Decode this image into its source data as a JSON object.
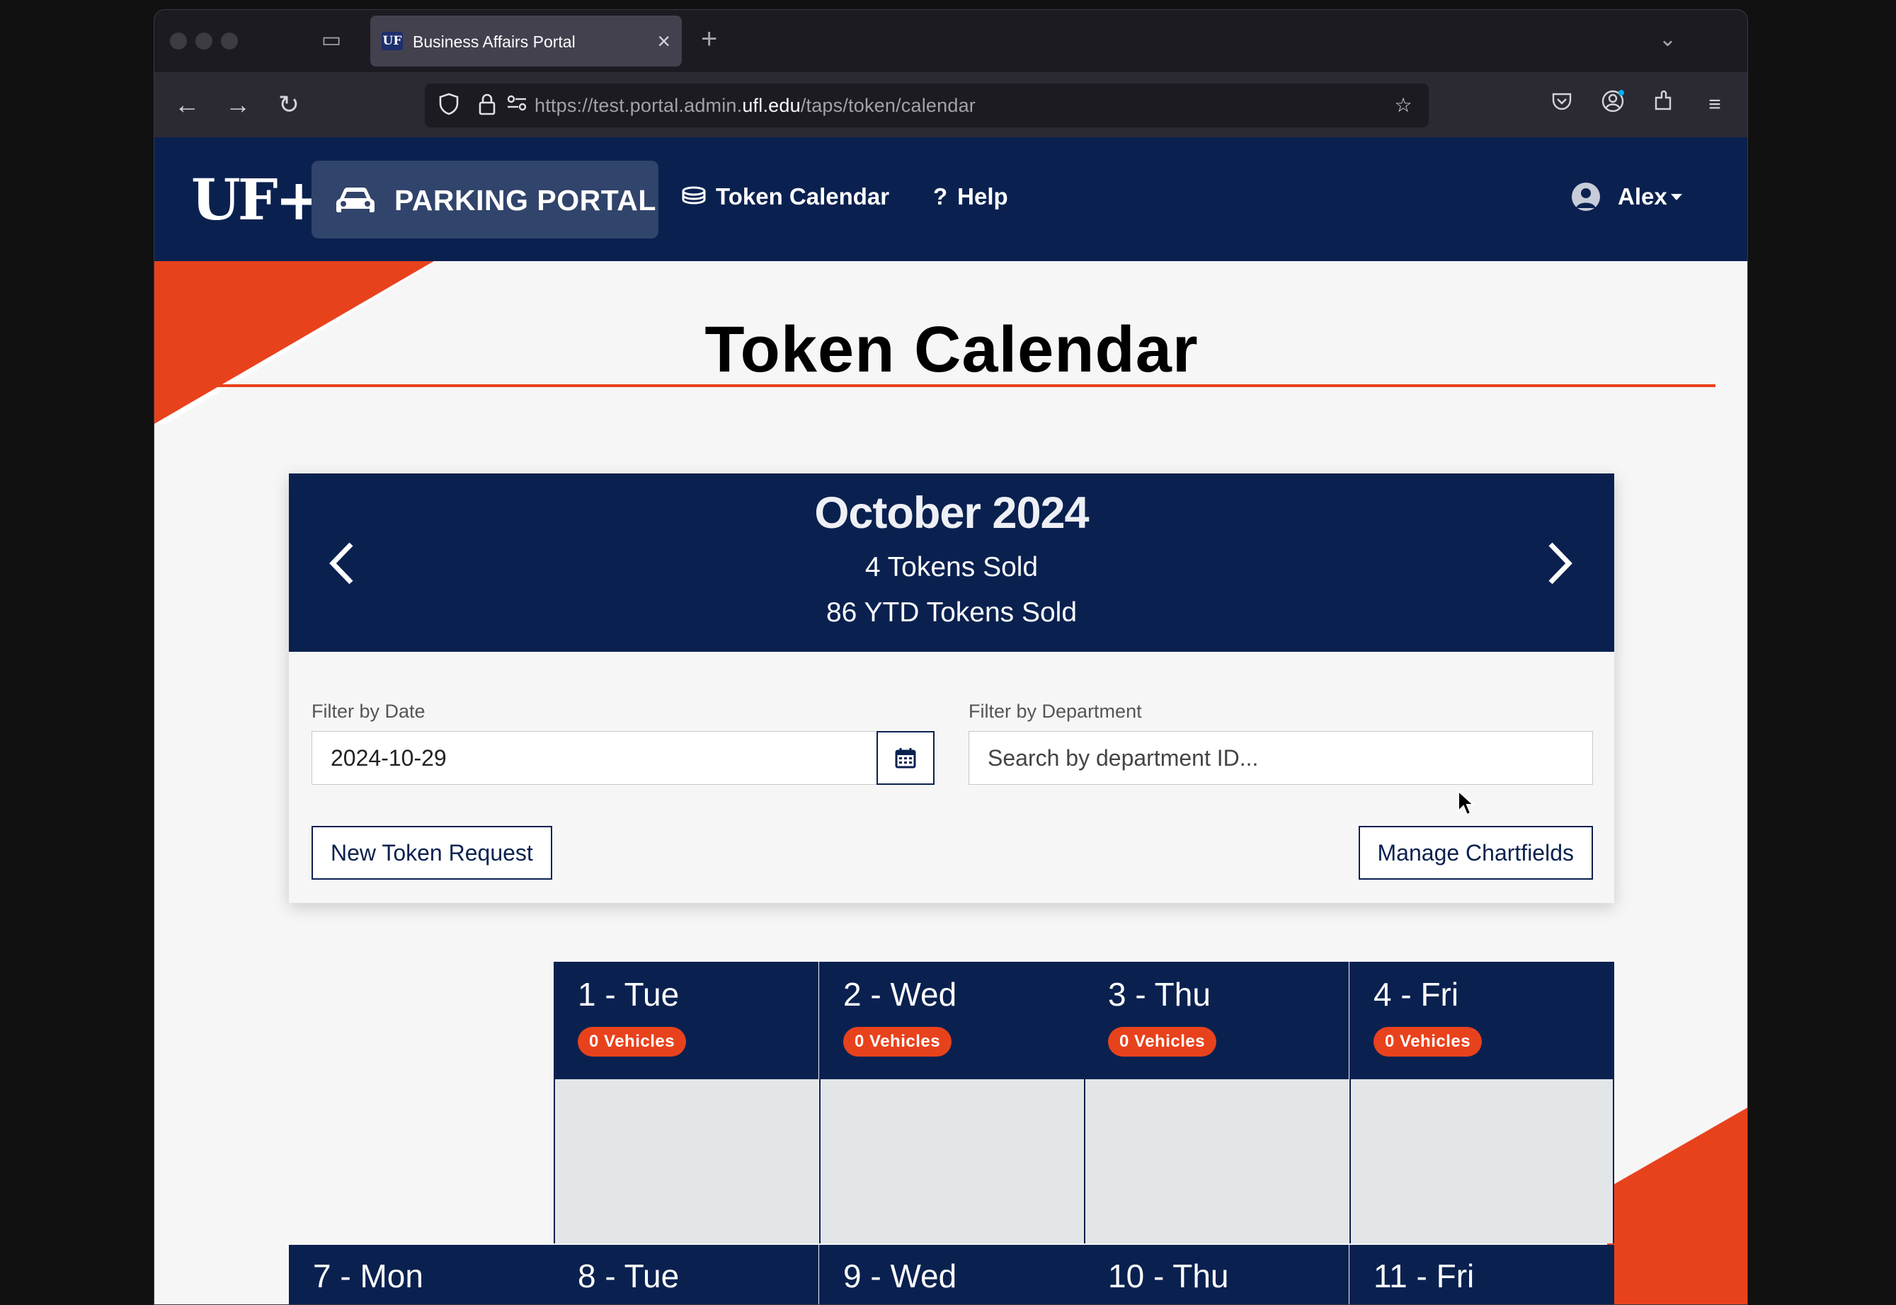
{
  "browser": {
    "tab_favicon": "UF",
    "tab_title": "Business Affairs Portal",
    "url_prefix": "https://test.portal.admin.",
    "url_domain": "ufl.edu",
    "url_path": "/taps/token/calendar"
  },
  "navbar": {
    "brand": "UF+",
    "portal_label": "PARKING PORTAL",
    "token_calendar_label": "Token Calendar",
    "help_label": "Help",
    "help_icon": "?",
    "user_name": "Alex"
  },
  "page": {
    "title": "Token Calendar"
  },
  "calendar": {
    "month": "October 2024",
    "tokens_sold": "4 Tokens Sold",
    "ytd_tokens_sold": "86 YTD Tokens Sold"
  },
  "filters": {
    "date_label": "Filter by Date",
    "date_value": "2024-10-29",
    "department_label": "Filter by Department",
    "department_placeholder": "Search by department ID..."
  },
  "actions": {
    "new_token_request": "New Token Request",
    "manage_chartfields": "Manage Chartfields"
  },
  "week1": [
    {
      "day": "1 - Tue",
      "badge": "0 Vehicles"
    },
    {
      "day": "2 - Wed",
      "badge": "0 Vehicles"
    },
    {
      "day": "3 - Thu",
      "badge": "0 Vehicles"
    },
    {
      "day": "4 - Fri",
      "badge": "0 Vehicles"
    }
  ],
  "week2": [
    {
      "day": "7 - Mon"
    },
    {
      "day": "8 - Tue"
    },
    {
      "day": "9 - Wed"
    },
    {
      "day": "10 - Thu"
    },
    {
      "day": "11 - Fri"
    }
  ],
  "colors": {
    "navy": "#0a2150",
    "orange": "#e8421d",
    "background": "#f6f6f6"
  }
}
